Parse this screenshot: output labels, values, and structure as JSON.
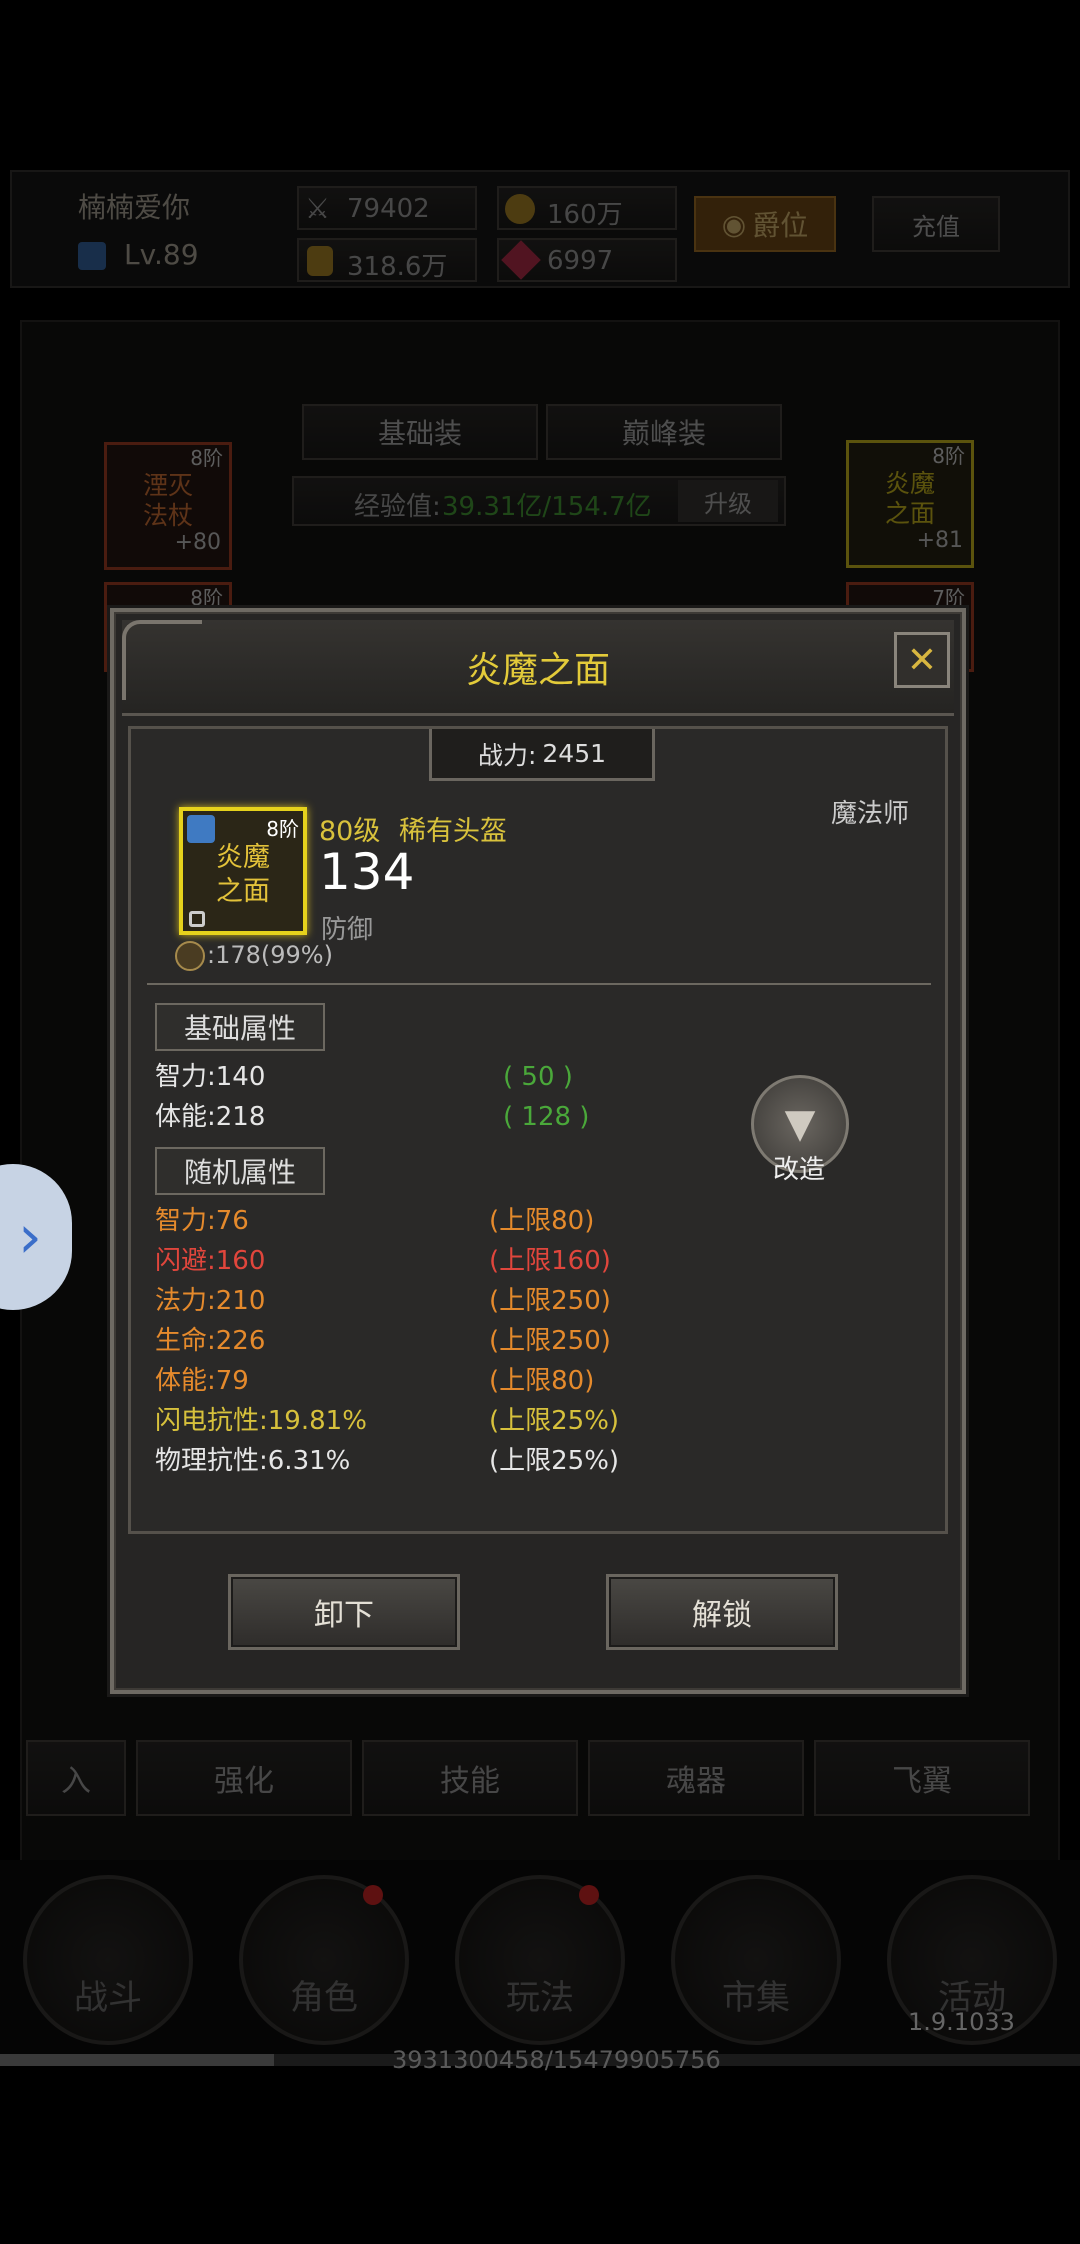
{
  "header": {
    "player_name": "楠楠爱你",
    "level": "Lv.89",
    "power_value": "79402",
    "gold_value": "160万",
    "hp_value": "318.6万",
    "gem_value": "6997",
    "rank_button": "爵位",
    "recharge_button": "充值"
  },
  "equip_tabs": {
    "basic": "基础装",
    "peak": "巅峰装"
  },
  "exp": {
    "label": "经验值:",
    "value": "39.31亿/154.7亿",
    "upgrade_button": "升级"
  },
  "bg_slots": {
    "left_tier": "8阶",
    "left_name": "湮灭法杖",
    "left_plus": "+80",
    "right_tier": "8阶",
    "right_name": "炎魔之面",
    "right_plus": "+81",
    "left2_tier": "8阶",
    "right2_tier": "7阶"
  },
  "bottom_tabs": [
    "入",
    "强化",
    "技能",
    "魂器",
    "飞翼"
  ],
  "nav": [
    "战斗",
    "角色",
    "玩法",
    "市集",
    "活动"
  ],
  "version": "1.9.1033",
  "footer_counter": "3931300458/15479905756",
  "dialog": {
    "title": "炎魔之面",
    "power_label": "战力:",
    "power_value": "2451",
    "item_tier": "8阶",
    "item_name": "炎魔之面",
    "item_level": "80级",
    "item_rarity": "稀有头盔",
    "class": "魔法师",
    "main_value": "134",
    "main_label": "防御",
    "durability": ":178(99%)",
    "base_section": "基础属性",
    "base_attrs": [
      {
        "name": "智力:140",
        "bonus": "( 50 )"
      },
      {
        "name": "体能:218",
        "bonus": "( 128 )"
      }
    ],
    "reforge_label": "改造",
    "random_section": "随机属性",
    "random_attrs": [
      {
        "name": "智力:76",
        "limit": "(上限80)",
        "color": "#e58a2c"
      },
      {
        "name": "闪避:160",
        "limit": "(上限160)",
        "color": "#e0463c"
      },
      {
        "name": "法力:210",
        "limit": "(上限250)",
        "color": "#e58a2c"
      },
      {
        "name": "生命:226",
        "limit": "(上限250)",
        "color": "#e58a2c"
      },
      {
        "name": "体能:79",
        "limit": "(上限80)",
        "color": "#e58a2c"
      },
      {
        "name": "闪电抗性:19.81%",
        "limit": "(上限25%)",
        "color": "#d7c13c"
      },
      {
        "name": "物理抗性:6.31%",
        "limit": "(上限25%)",
        "color": "#e6e6e6"
      }
    ],
    "unequip_button": "卸下",
    "unlock_button": "解锁",
    "close_label": "✕"
  },
  "side_arrow": "›"
}
